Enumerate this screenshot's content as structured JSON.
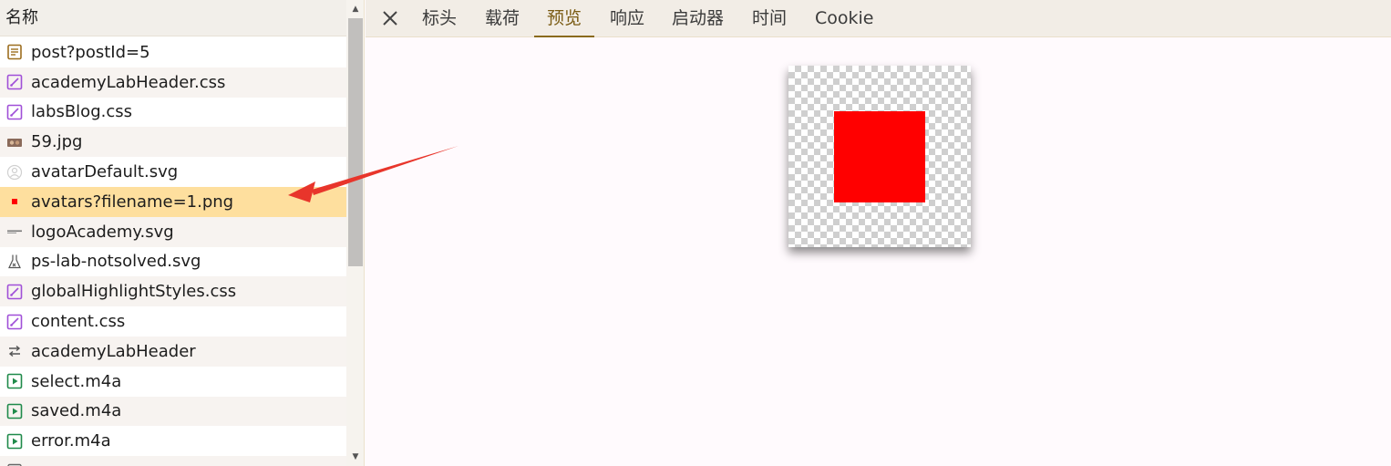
{
  "list": {
    "header": "名称",
    "rows": [
      {
        "name": "post?postId=5",
        "icon": "document-icon",
        "selected": false
      },
      {
        "name": "academyLabHeader.css",
        "icon": "stylesheet-icon",
        "selected": false
      },
      {
        "name": "labsBlog.css",
        "icon": "stylesheet-icon",
        "selected": false
      },
      {
        "name": "59.jpg",
        "icon": "image-thumbnail-icon",
        "selected": false
      },
      {
        "name": "avatarDefault.svg",
        "icon": "avatar-icon",
        "selected": false
      },
      {
        "name": "avatars?filename=1.png",
        "icon": "red-square-icon",
        "selected": true
      },
      {
        "name": "logoAcademy.svg",
        "icon": "logo-icon",
        "selected": false
      },
      {
        "name": "ps-lab-notsolved.svg",
        "icon": "flask-icon",
        "selected": false
      },
      {
        "name": "globalHighlightStyles.css",
        "icon": "stylesheet-icon",
        "selected": false
      },
      {
        "name": "content.css",
        "icon": "stylesheet-icon",
        "selected": false
      },
      {
        "name": "academyLabHeader",
        "icon": "websocket-icon",
        "selected": false
      },
      {
        "name": "select.m4a",
        "icon": "media-icon",
        "selected": false
      },
      {
        "name": "saved.m4a",
        "icon": "media-icon",
        "selected": false
      },
      {
        "name": "error.m4a",
        "icon": "media-icon",
        "selected": false
      }
    ]
  },
  "tabs": [
    {
      "label": "标头",
      "active": false
    },
    {
      "label": "载荷",
      "active": false
    },
    {
      "label": "预览",
      "active": true
    },
    {
      "label": "响应",
      "active": false
    },
    {
      "label": "启动器",
      "active": false
    },
    {
      "label": "时间",
      "active": false
    },
    {
      "label": "Cookie",
      "active": false
    }
  ],
  "colors": {
    "selected_row": "#fedf9e",
    "preview_fill": "#ff0000",
    "arrow": "#e8352b",
    "active_tab": "#7a5b13"
  }
}
